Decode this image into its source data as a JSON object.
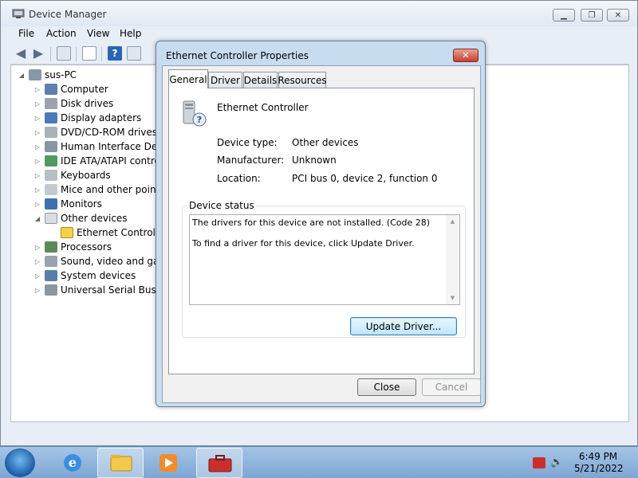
{
  "window": {
    "title": "Device Manager"
  },
  "menu": [
    "File",
    "Action",
    "View",
    "Help"
  ],
  "tree": {
    "root": "sus-PC",
    "items": [
      "Computer",
      "Disk drives",
      "Display adapters",
      "DVD/CD-ROM drives",
      "Human Interface Devic",
      "IDE ATA/ATAPI contro",
      "Keyboards",
      "Mice and other pointin",
      "Monitors",
      "Other devices",
      "Ethernet Controller",
      "Processors",
      "Sound, video and gam",
      "System devices",
      "Universal Serial Bus co"
    ]
  },
  "dialog": {
    "title": "Ethernet Controller Properties",
    "tabs": [
      "General",
      "Driver",
      "Details",
      "Resources"
    ],
    "device_name": "Ethernet Controller",
    "properties": [
      {
        "label": "Device type:",
        "value": "Other devices"
      },
      {
        "label": "Manufacturer:",
        "value": "Unknown"
      },
      {
        "label": "Location:",
        "value": "PCI bus 0, device 2, function 0"
      }
    ],
    "status_group": "Device status",
    "status_lines": [
      "The drivers for this device are not installed. (Code 28)",
      "To find a driver for this device, click Update Driver."
    ],
    "update_button": "Update Driver...",
    "close_button": "Close",
    "cancel_button": "Cancel"
  },
  "taskbar": {
    "time": "6:49 PM",
    "date": "5/21/2022"
  },
  "icons": {
    "app": "device-manager-icon",
    "start": "windows-start-icon",
    "ie": "internet-explorer-icon",
    "explorer": "folder-icon",
    "media": "media-player-icon",
    "toolbox": "toolbox-icon"
  }
}
